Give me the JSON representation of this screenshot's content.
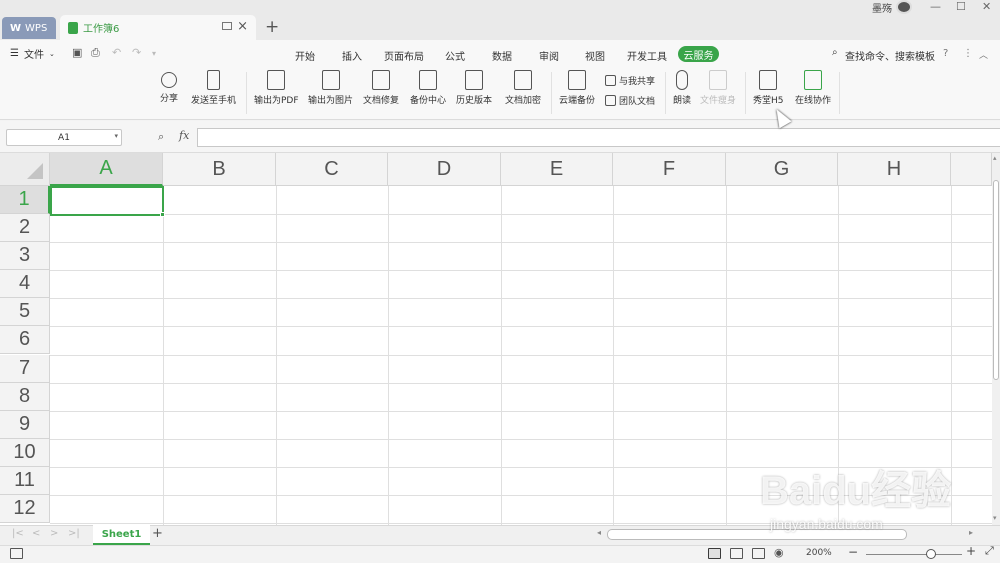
{
  "tabs": {
    "app": "WPS",
    "document": "工作簿6"
  },
  "user": {
    "name": "墨殇"
  },
  "menu": {
    "file": "文件",
    "items": [
      "开始",
      "插入",
      "页面布局",
      "公式",
      "数据",
      "审阅",
      "视图",
      "开发工具"
    ],
    "active": "云服务",
    "search": "查找命令、搜索模板",
    "help": "?"
  },
  "ribbon": {
    "share": "分享",
    "send_phone": "发送至手机",
    "export_pdf": "输出为PDF",
    "export_image": "输出为图片",
    "repair": "文档修复",
    "backup_center": "备份中心",
    "history": "历史版本",
    "encrypt": "文档加密",
    "cloud_backup": "云端备份",
    "shared_with_me": "与我共享",
    "team_docs": "团队文档",
    "read_aloud": "朗读",
    "file_slim": "文件瘦身",
    "h5": "秀堂H5",
    "online_collab": "在线协作"
  },
  "formula_bar": {
    "cell_ref": "A1",
    "fx": "fx",
    "formula": ""
  },
  "grid": {
    "columns": [
      "A",
      "B",
      "C",
      "D",
      "E",
      "F",
      "G",
      "H"
    ],
    "rows": [
      "1",
      "2",
      "3",
      "4",
      "5",
      "6",
      "7",
      "8",
      "9",
      "10",
      "11",
      "12"
    ],
    "active_cell": "A1"
  },
  "sheets": {
    "names": [
      "Sheet1"
    ],
    "add": "+"
  },
  "status": {
    "zoom": "200%",
    "zoom_level": 0.68
  },
  "watermark": {
    "main": "Baidu经验",
    "url": "jingyan.baidu.com"
  },
  "colors": {
    "accent": "#3aa54a",
    "wps_tab": "#8a9ab8"
  }
}
